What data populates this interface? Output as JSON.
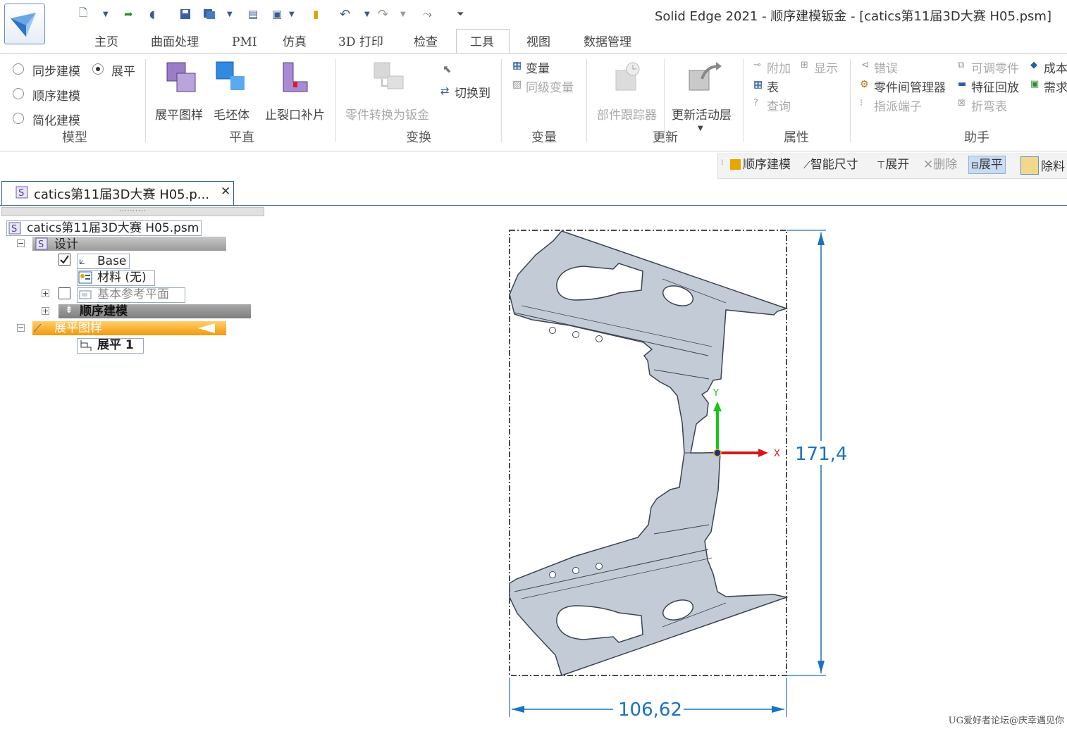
{
  "window": {
    "title": "Solid Edge 2021 - 顺序建模钣金 - [catics第11届3D大赛 H05.psm]"
  },
  "tabs": [
    "主页",
    "曲面处理",
    "PMI",
    "仿真",
    "3D 打印",
    "检查",
    "工具",
    "视图",
    "数据管理"
  ],
  "active_tab": "工具",
  "ribbon": {
    "model_group": {
      "label": "模型",
      "options": [
        "同步建模",
        "顺序建模",
        "简化建模"
      ],
      "flat_option": "展平",
      "selected": "展平"
    },
    "plane_group": {
      "label": "平直",
      "buttons": [
        "展平图样",
        "毛坯体",
        "止裂口补片"
      ]
    },
    "transform_group": {
      "label": "变换",
      "convert": "零件转换为钣金",
      "switch_to": "切换到"
    },
    "variables_group": {
      "label": "变量",
      "variables": "变量",
      "peer_variables": "同级变量"
    },
    "update_group": {
      "label": "更新",
      "part_tracker": "部件跟踪器",
      "update_active": "更新活动层"
    },
    "properties_group": {
      "label": "属性",
      "attach": "附加",
      "show": "显示",
      "table": "表",
      "query": "查询"
    },
    "assistant_group": {
      "label": "助手",
      "errors": "错误",
      "interpart_manager": "零件间管理器",
      "assign_terminal": "指派端子",
      "adjustable_part": "可调零件",
      "feature_playback": "特征回放",
      "bend_table": "折弯表",
      "cost": "成本",
      "requirements": "需求"
    }
  },
  "command_bar": {
    "ordered_modeling": "顺序建模",
    "smart_dimension": "智能尺寸",
    "unfold": "展开",
    "delete": "删除",
    "flatten": "展平",
    "remove_material": "除料"
  },
  "document_tab": {
    "label": "catics第11届3D大赛 H05.p...",
    "close": "✕"
  },
  "tree": {
    "root": "catics第11届3D大赛 H05.psm",
    "design": "设计",
    "base": "Base",
    "material": "材料 (无)",
    "ref_planes": "基本参考平面",
    "ordered_modeling": "顺序建模",
    "flat_pattern": "展平图样",
    "flatten1": "展平 1"
  },
  "canvas": {
    "height_dimension": "171,4",
    "width_dimension": "106,62",
    "axis_x": "X",
    "axis_y": "Y"
  },
  "watermark": "UG爱好者论坛@庆幸遇见你",
  "colors": {
    "accent": "#2f5f9e",
    "dimension": "#1a72c0",
    "part": "#c3ccd6",
    "flat_pattern_highlight": "#f5a623"
  }
}
